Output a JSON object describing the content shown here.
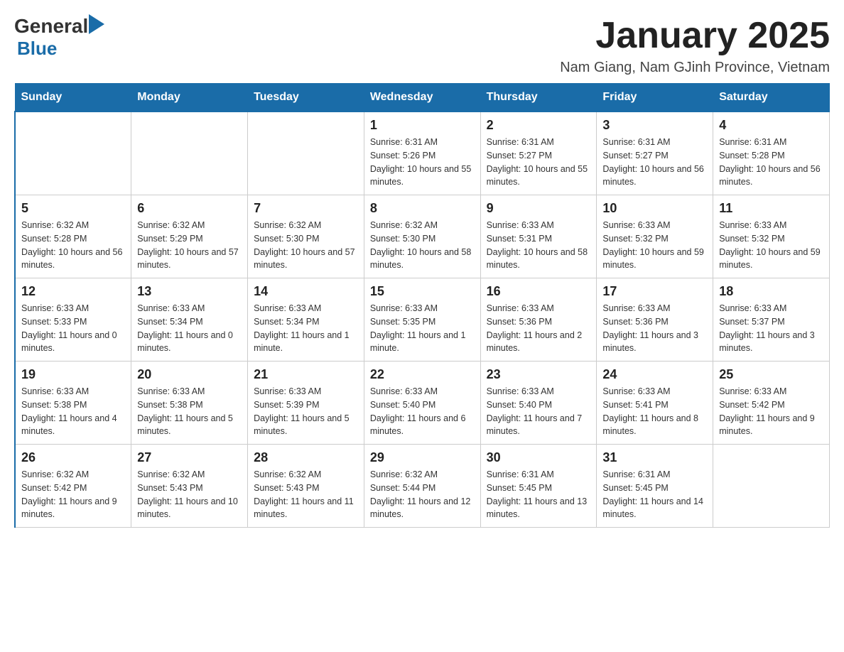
{
  "header": {
    "logo_general": "General",
    "logo_blue": "Blue",
    "main_title": "January 2025",
    "subtitle": "Nam Giang, Nam GJinh Province, Vietnam"
  },
  "calendar": {
    "days_of_week": [
      "Sunday",
      "Monday",
      "Tuesday",
      "Wednesday",
      "Thursday",
      "Friday",
      "Saturday"
    ],
    "weeks": [
      [
        {
          "day": "",
          "info": ""
        },
        {
          "day": "",
          "info": ""
        },
        {
          "day": "",
          "info": ""
        },
        {
          "day": "1",
          "info": "Sunrise: 6:31 AM\nSunset: 5:26 PM\nDaylight: 10 hours and 55 minutes."
        },
        {
          "day": "2",
          "info": "Sunrise: 6:31 AM\nSunset: 5:27 PM\nDaylight: 10 hours and 55 minutes."
        },
        {
          "day": "3",
          "info": "Sunrise: 6:31 AM\nSunset: 5:27 PM\nDaylight: 10 hours and 56 minutes."
        },
        {
          "day": "4",
          "info": "Sunrise: 6:31 AM\nSunset: 5:28 PM\nDaylight: 10 hours and 56 minutes."
        }
      ],
      [
        {
          "day": "5",
          "info": "Sunrise: 6:32 AM\nSunset: 5:28 PM\nDaylight: 10 hours and 56 minutes."
        },
        {
          "day": "6",
          "info": "Sunrise: 6:32 AM\nSunset: 5:29 PM\nDaylight: 10 hours and 57 minutes."
        },
        {
          "day": "7",
          "info": "Sunrise: 6:32 AM\nSunset: 5:30 PM\nDaylight: 10 hours and 57 minutes."
        },
        {
          "day": "8",
          "info": "Sunrise: 6:32 AM\nSunset: 5:30 PM\nDaylight: 10 hours and 58 minutes."
        },
        {
          "day": "9",
          "info": "Sunrise: 6:33 AM\nSunset: 5:31 PM\nDaylight: 10 hours and 58 minutes."
        },
        {
          "day": "10",
          "info": "Sunrise: 6:33 AM\nSunset: 5:32 PM\nDaylight: 10 hours and 59 minutes."
        },
        {
          "day": "11",
          "info": "Sunrise: 6:33 AM\nSunset: 5:32 PM\nDaylight: 10 hours and 59 minutes."
        }
      ],
      [
        {
          "day": "12",
          "info": "Sunrise: 6:33 AM\nSunset: 5:33 PM\nDaylight: 11 hours and 0 minutes."
        },
        {
          "day": "13",
          "info": "Sunrise: 6:33 AM\nSunset: 5:34 PM\nDaylight: 11 hours and 0 minutes."
        },
        {
          "day": "14",
          "info": "Sunrise: 6:33 AM\nSunset: 5:34 PM\nDaylight: 11 hours and 1 minute."
        },
        {
          "day": "15",
          "info": "Sunrise: 6:33 AM\nSunset: 5:35 PM\nDaylight: 11 hours and 1 minute."
        },
        {
          "day": "16",
          "info": "Sunrise: 6:33 AM\nSunset: 5:36 PM\nDaylight: 11 hours and 2 minutes."
        },
        {
          "day": "17",
          "info": "Sunrise: 6:33 AM\nSunset: 5:36 PM\nDaylight: 11 hours and 3 minutes."
        },
        {
          "day": "18",
          "info": "Sunrise: 6:33 AM\nSunset: 5:37 PM\nDaylight: 11 hours and 3 minutes."
        }
      ],
      [
        {
          "day": "19",
          "info": "Sunrise: 6:33 AM\nSunset: 5:38 PM\nDaylight: 11 hours and 4 minutes."
        },
        {
          "day": "20",
          "info": "Sunrise: 6:33 AM\nSunset: 5:38 PM\nDaylight: 11 hours and 5 minutes."
        },
        {
          "day": "21",
          "info": "Sunrise: 6:33 AM\nSunset: 5:39 PM\nDaylight: 11 hours and 5 minutes."
        },
        {
          "day": "22",
          "info": "Sunrise: 6:33 AM\nSunset: 5:40 PM\nDaylight: 11 hours and 6 minutes."
        },
        {
          "day": "23",
          "info": "Sunrise: 6:33 AM\nSunset: 5:40 PM\nDaylight: 11 hours and 7 minutes."
        },
        {
          "day": "24",
          "info": "Sunrise: 6:33 AM\nSunset: 5:41 PM\nDaylight: 11 hours and 8 minutes."
        },
        {
          "day": "25",
          "info": "Sunrise: 6:33 AM\nSunset: 5:42 PM\nDaylight: 11 hours and 9 minutes."
        }
      ],
      [
        {
          "day": "26",
          "info": "Sunrise: 6:32 AM\nSunset: 5:42 PM\nDaylight: 11 hours and 9 minutes."
        },
        {
          "day": "27",
          "info": "Sunrise: 6:32 AM\nSunset: 5:43 PM\nDaylight: 11 hours and 10 minutes."
        },
        {
          "day": "28",
          "info": "Sunrise: 6:32 AM\nSunset: 5:43 PM\nDaylight: 11 hours and 11 minutes."
        },
        {
          "day": "29",
          "info": "Sunrise: 6:32 AM\nSunset: 5:44 PM\nDaylight: 11 hours and 12 minutes."
        },
        {
          "day": "30",
          "info": "Sunrise: 6:31 AM\nSunset: 5:45 PM\nDaylight: 11 hours and 13 minutes."
        },
        {
          "day": "31",
          "info": "Sunrise: 6:31 AM\nSunset: 5:45 PM\nDaylight: 11 hours and 14 minutes."
        },
        {
          "day": "",
          "info": ""
        }
      ]
    ]
  }
}
